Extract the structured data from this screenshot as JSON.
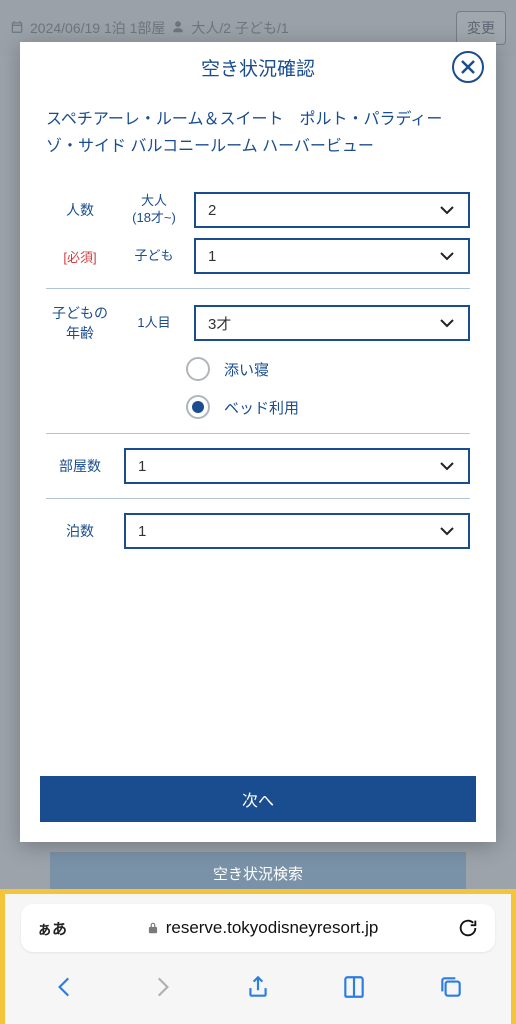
{
  "bg_header": {
    "date_text": "2024/06/19 1泊 1部屋",
    "guest_text": "大人/2 子ども/1",
    "change_label": "変更"
  },
  "bg_search_label": "空き状況検索",
  "modal": {
    "title": "空き状況確認",
    "room_name": "スペチアーレ・ルーム＆スイート　ポルト・パラディーゾ・サイド バルコニールーム ハーバービュー",
    "guests": {
      "label": "人数",
      "required": "[必須]",
      "adult_label": "大人\n(18才~)",
      "adult_value": "2",
      "child_label": "子ども",
      "child_value": "1"
    },
    "child_age": {
      "label": "子どもの\n年齢",
      "person_label": "1人目",
      "age_value": "3才",
      "radio_soi": "添い寝",
      "radio_bed": "ベッド利用"
    },
    "rooms": {
      "label": "部屋数",
      "value": "1"
    },
    "nights": {
      "label": "泊数",
      "value": "1"
    },
    "next_label": "次へ"
  },
  "safari": {
    "aa": "ぁあ",
    "url": "reserve.tokyodisneyresort.jp"
  }
}
